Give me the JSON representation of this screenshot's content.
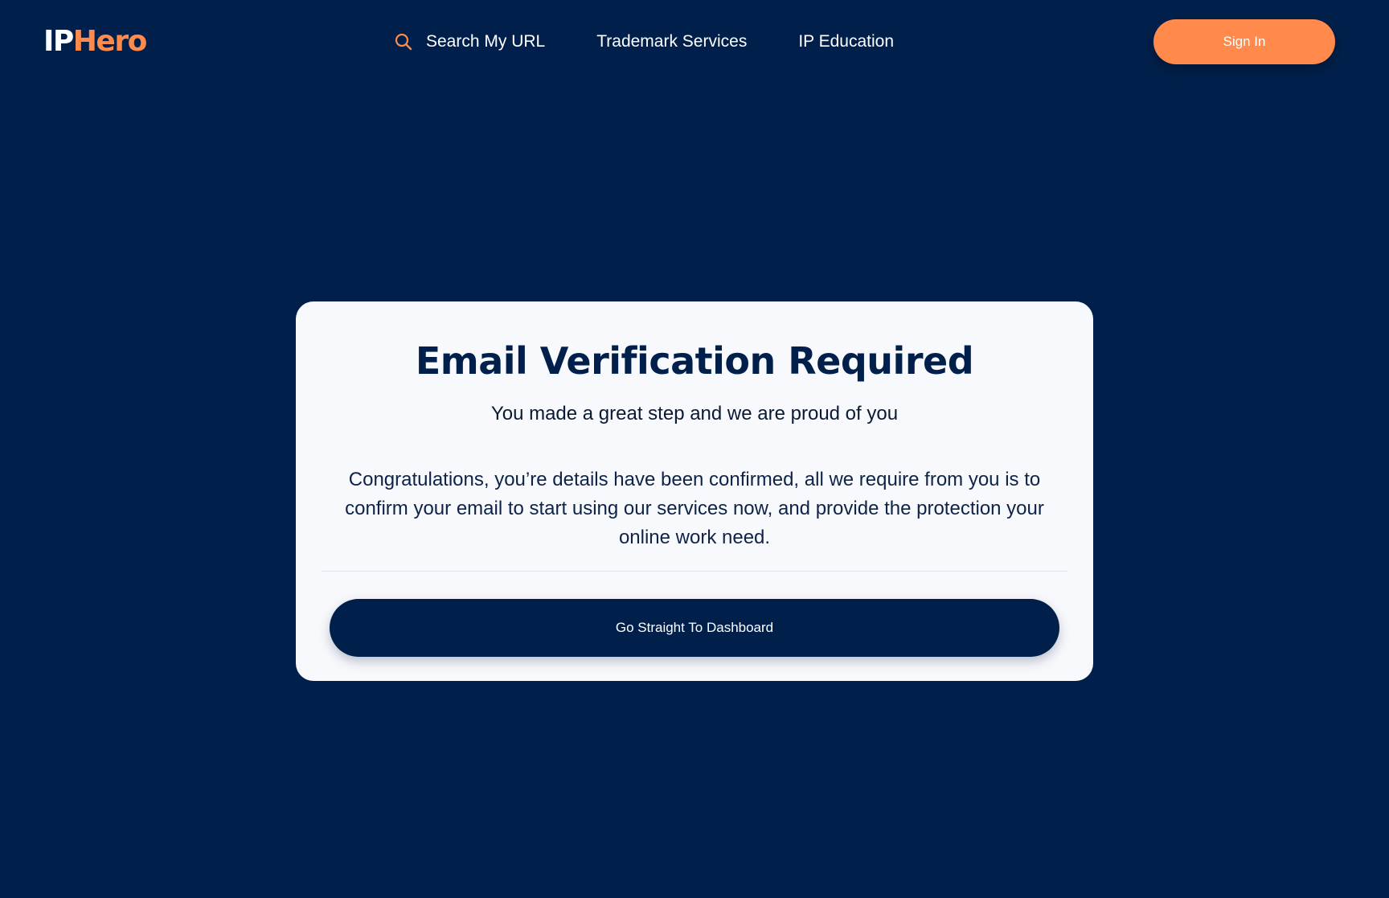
{
  "header": {
    "logo": {
      "part1": "IP",
      "part2": "Hero"
    },
    "nav": [
      {
        "label": "Search My URL",
        "icon": "search-icon"
      },
      {
        "label": "Trademark Services"
      },
      {
        "label": "IP Education"
      }
    ],
    "signin_label": "Sign In"
  },
  "card": {
    "title": "Email Verification Required",
    "subtitle": "You made a great step and we are proud of you",
    "body": "Congratulations, you’re details have been confirmed, all we require from you is to confirm your email to start using our services now, and provide the protection your online work need.",
    "button_label": "Go Straight To Dashboard"
  },
  "colors": {
    "background": "#00204b",
    "accent": "#ff8a4c",
    "card": "#f8f9fc"
  }
}
